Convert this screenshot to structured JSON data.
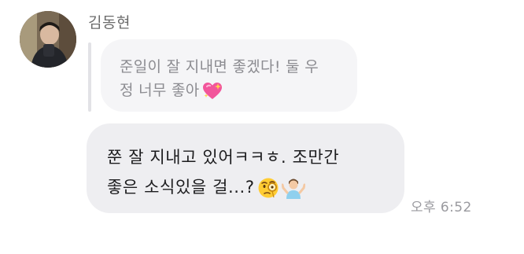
{
  "chat": {
    "sender_name": "김동현",
    "quoted_message": {
      "line1": "준일이 잘 지내면 좋겠다! 둘 우",
      "line2": "정 너무 좋아",
      "emoji": "sparkling-heart-icon"
    },
    "message": {
      "line1": "쭌 잘 지내고 있어ㅋㅋㅎ. 조만간",
      "line2": "좋은 소식있을 걸...?",
      "emojis": [
        "face-with-monocle-icon",
        "person-shrugging-icon"
      ]
    },
    "timestamp": "오후 6:52"
  },
  "colors": {
    "quote_bubble": "#f5f5f7",
    "message_bubble": "#eeeef1",
    "quote_text": "#8c8c91",
    "message_text": "#1c1c1e",
    "meta_text": "#9a9a9f"
  }
}
